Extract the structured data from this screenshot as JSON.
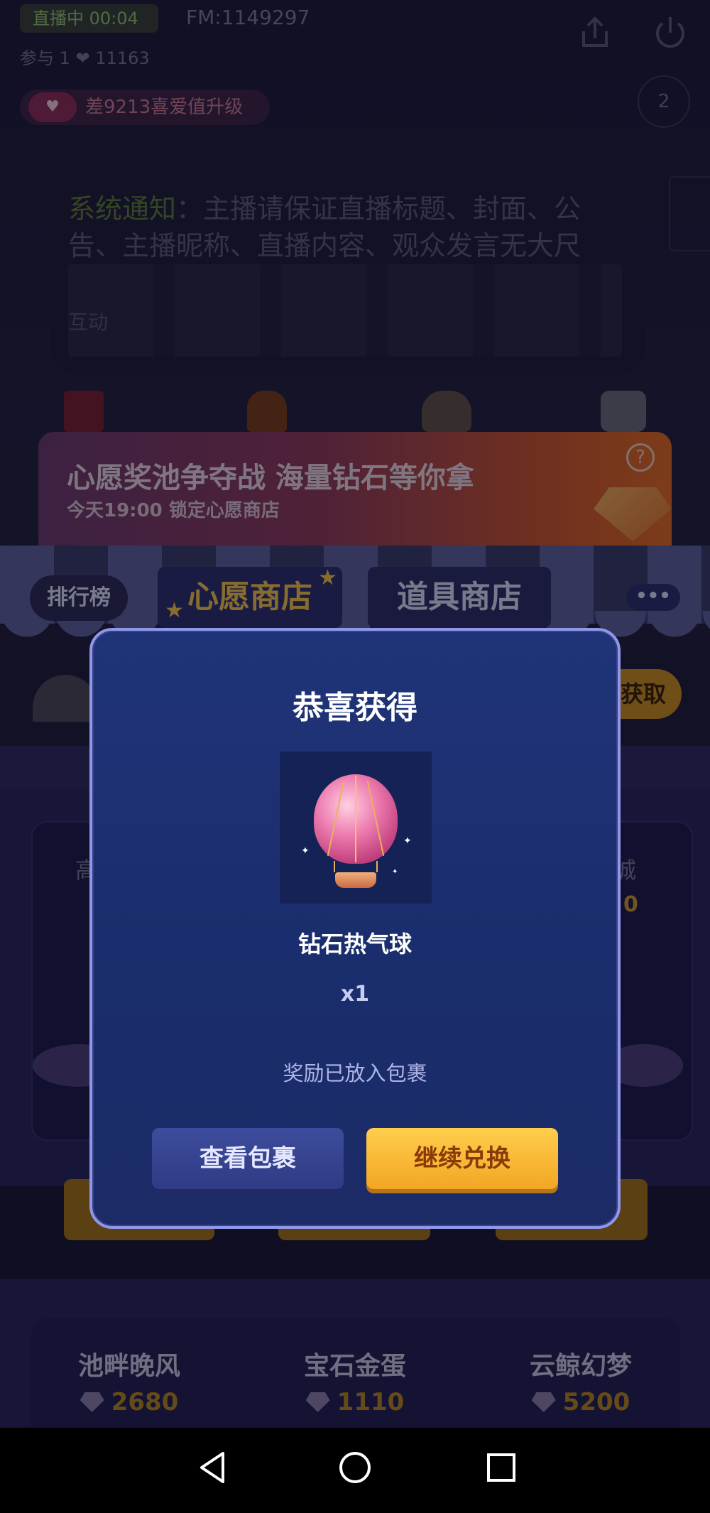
{
  "status": {
    "tag": "直播中 00:04",
    "fm_id": "FM:1149297",
    "fans": "参与 1  ❤ 11163",
    "love_goal": "差9213喜爱值升级",
    "rank_badge": "2"
  },
  "notice": {
    "label": "系统通知",
    "text": "：主播请保证直播标题、封面、公告、主播昵称、直播内容、观众发言无大尺",
    "interact": "互动"
  },
  "banner": {
    "title": "心愿奖池争夺战 海量钻石等你拿",
    "subtitle": "今天19:00 锁定心愿商店",
    "help_label": "?"
  },
  "shop_tabs": {
    "rank": "排行榜",
    "wish_shop": "心愿商店",
    "prop_shop": "道具商店",
    "more": "•••"
  },
  "get_button": "获取",
  "shelf": {
    "left_name_partial": "高",
    "right_name_partial": "城",
    "right_price_partial": "0"
  },
  "items": [
    {
      "name": "池畔晚风",
      "price": "2680"
    },
    {
      "name": "宝石金蛋",
      "price": "1110"
    },
    {
      "name": "云鲸幻梦",
      "price": "5200"
    }
  ],
  "dialog": {
    "title": "恭喜获得",
    "prize_name": "钻石热气球",
    "prize_count": "x1",
    "note": "奖励已放入包裹",
    "view_button": "查看包裹",
    "continue_button": "继续兑换"
  },
  "colors": {
    "dialog_bg": "#1d316f",
    "dialog_border": "#8f98e8",
    "continue_button": "#f7b52f",
    "accent_gold": "#f2c14a"
  }
}
